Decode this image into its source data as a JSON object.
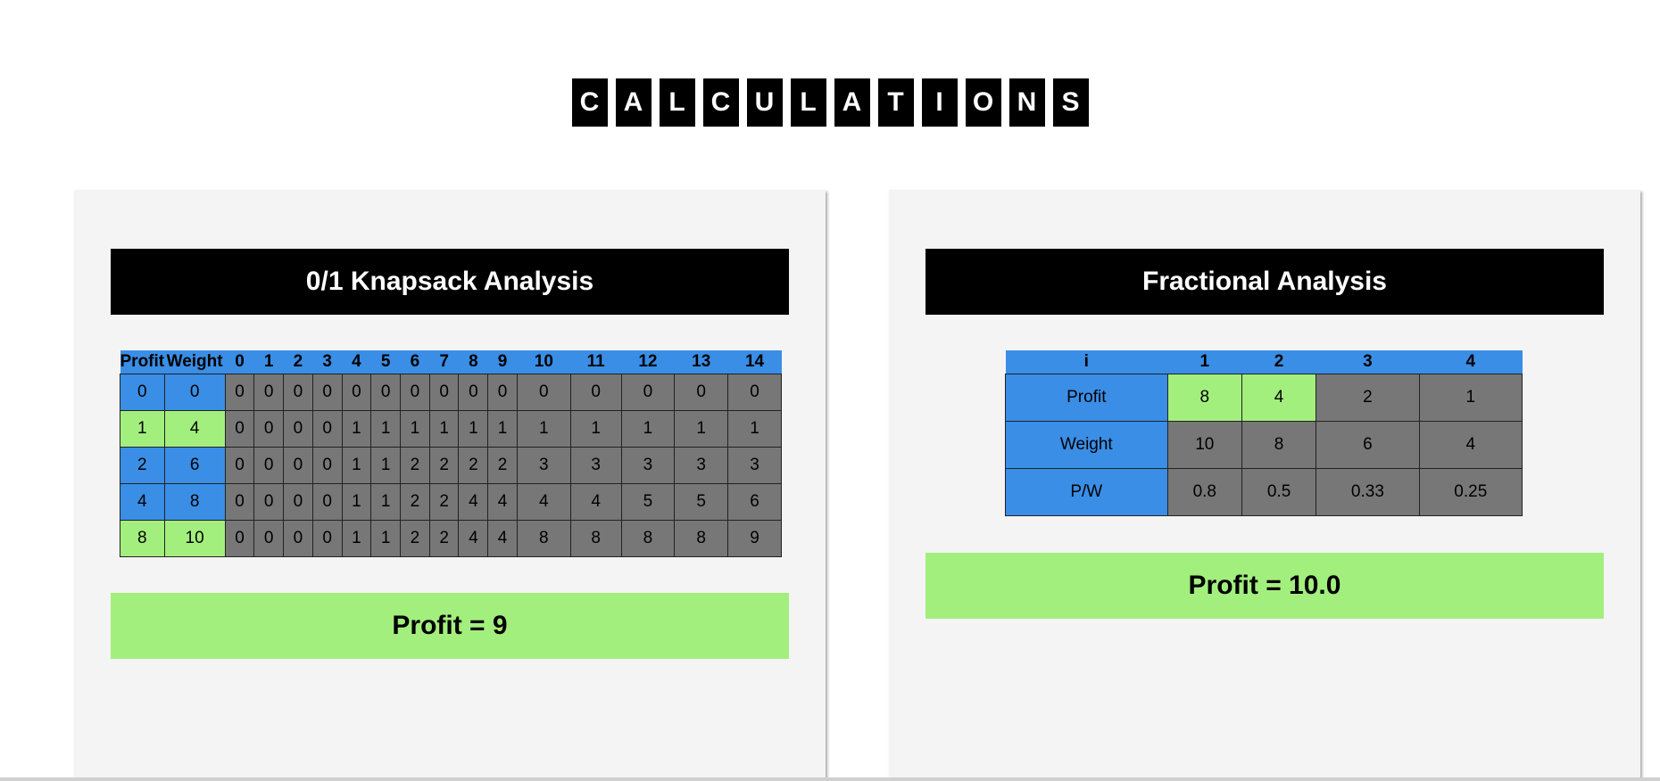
{
  "title": [
    "C",
    "A",
    "L",
    "C",
    "U",
    "L",
    "A",
    "T",
    "I",
    "O",
    "N",
    "S"
  ],
  "colors": {
    "header_blue": "#3a8ee6",
    "highlight_green": "#a3ef7d",
    "cell_gray": "#777777",
    "panel_bg": "#f4f4f4",
    "header_black": "#000000"
  },
  "knapsack": {
    "title": "0/1 Knapsack Analysis",
    "headers": [
      "Profit",
      "Weight",
      "0",
      "1",
      "2",
      "3",
      "4",
      "5",
      "6",
      "7",
      "8",
      "9",
      "10",
      "11",
      "12",
      "13",
      "14"
    ],
    "rows": [
      {
        "profit": "0",
        "weight": "0",
        "highlight": false,
        "cells": [
          "0",
          "0",
          "0",
          "0",
          "0",
          "0",
          "0",
          "0",
          "0",
          "0",
          "0",
          "0",
          "0",
          "0",
          "0"
        ]
      },
      {
        "profit": "1",
        "weight": "4",
        "highlight": true,
        "cells": [
          "0",
          "0",
          "0",
          "0",
          "1",
          "1",
          "1",
          "1",
          "1",
          "1",
          "1",
          "1",
          "1",
          "1",
          "1"
        ]
      },
      {
        "profit": "2",
        "weight": "6",
        "highlight": false,
        "cells": [
          "0",
          "0",
          "0",
          "0",
          "1",
          "1",
          "2",
          "2",
          "2",
          "2",
          "3",
          "3",
          "3",
          "3",
          "3"
        ]
      },
      {
        "profit": "4",
        "weight": "8",
        "highlight": false,
        "cells": [
          "0",
          "0",
          "0",
          "0",
          "1",
          "1",
          "2",
          "2",
          "4",
          "4",
          "4",
          "4",
          "5",
          "5",
          "6"
        ]
      },
      {
        "profit": "8",
        "weight": "10",
        "highlight": true,
        "cells": [
          "0",
          "0",
          "0",
          "0",
          "1",
          "1",
          "2",
          "2",
          "4",
          "4",
          "8",
          "8",
          "8",
          "8",
          "9"
        ]
      }
    ],
    "result": "Profit = 9"
  },
  "fractional": {
    "title": "Fractional Analysis",
    "headers": [
      "i",
      "1",
      "2",
      "3",
      "4"
    ],
    "rows": [
      {
        "label": "Profit",
        "cells": [
          "8",
          "4",
          "2",
          "1"
        ],
        "green": [
          true,
          true,
          false,
          false
        ]
      },
      {
        "label": "Weight",
        "cells": [
          "10",
          "8",
          "6",
          "4"
        ],
        "green": [
          false,
          false,
          false,
          false
        ]
      },
      {
        "label": "P/W",
        "cells": [
          "0.8",
          "0.5",
          "0.33",
          "0.25"
        ],
        "green": [
          false,
          false,
          false,
          false
        ]
      }
    ],
    "result": "Profit = 10.0"
  }
}
